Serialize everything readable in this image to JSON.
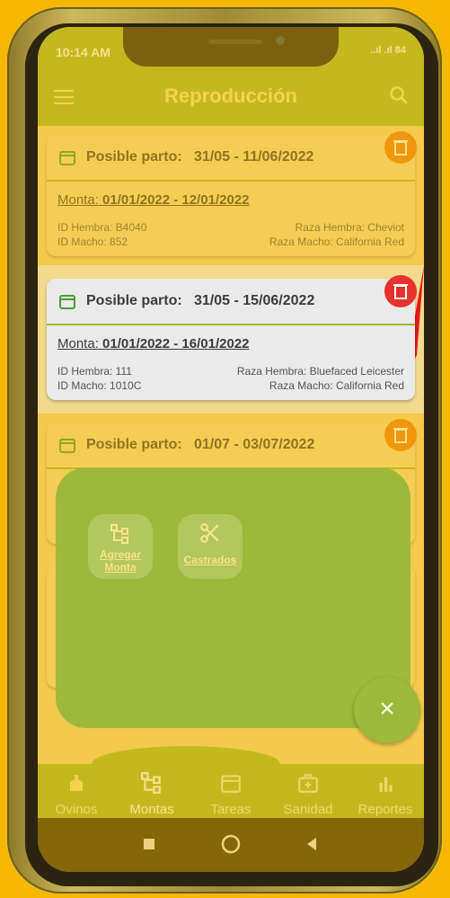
{
  "status": {
    "time": "10:14 AM",
    "signal": "..ıl .ıl 84"
  },
  "appbar": {
    "title": "Reproducción"
  },
  "cards": [
    {
      "label": "Posible parto:",
      "range": "31/05 - 11/06/2022",
      "monta_label": "Monta:",
      "monta": "01/01/2022 - 12/01/2022",
      "id_hembra": "ID Hembra: B4040",
      "id_macho": "ID Macho: 852",
      "raza_hembra": "Raza Hembra: Cheviot",
      "raza_macho": "Raza Macho: California Red"
    },
    {
      "label": "Posible parto:",
      "range": "31/05 - 15/06/2022",
      "monta_label": "Monta:",
      "monta": "01/01/2022 - 16/01/2022",
      "id_hembra": "ID Hembra: 111",
      "id_macho": "ID Macho: 1010C",
      "raza_hembra": "Raza Hembra: Bluefaced Leicester",
      "raza_macho": "Raza Macho: California Red"
    },
    {
      "label": "Posible parto:",
      "range": "01/07 - 03/07/2022"
    }
  ],
  "fab": {
    "agregar": "Agregar Monta",
    "castrados": "Castrados",
    "close": "×"
  },
  "nav": {
    "ovinos": "Ovinos",
    "montas": "Montas",
    "tareas": "Tareas",
    "sanidad": "Sanidad",
    "reportes": "Reportes"
  },
  "colors": {
    "primary": "#9db83a",
    "accent_yellow": "#f6e58d",
    "delete_orange": "#f07b1a",
    "delete_red": "#e8322e",
    "background": "#f4b800"
  }
}
